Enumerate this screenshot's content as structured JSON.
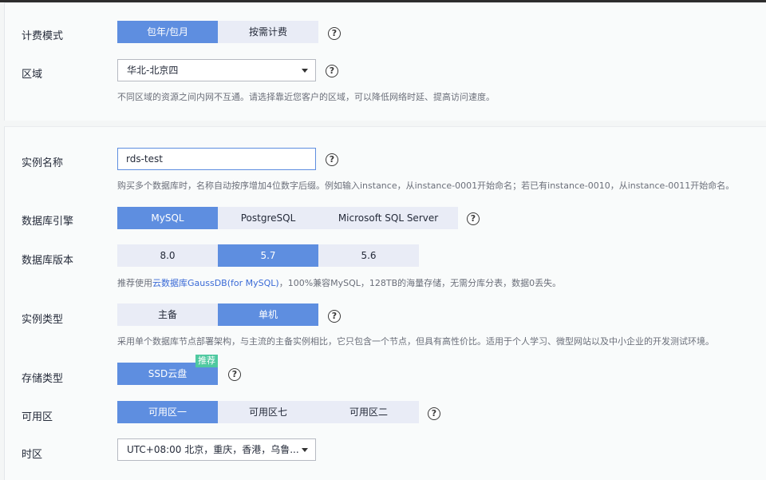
{
  "billing": {
    "label": "计费模式",
    "options": [
      "包年/包月",
      "按需计费"
    ],
    "selected": "包年/包月"
  },
  "region": {
    "label": "区域",
    "value": "华北-北京四",
    "hint": "不同区域的资源之间内网不互通。请选择靠近您客户的区域，可以降低网络时延、提高访问速度。"
  },
  "instance_name": {
    "label": "实例名称",
    "value": "rds-test",
    "hint": "购买多个数据库时，名称自动按序增加4位数字后缀。例如输入instance，从instance-0001开始命名；若已有instance-0010，从instance-0011开始命名。"
  },
  "engine": {
    "label": "数据库引擎",
    "options": [
      "MySQL",
      "PostgreSQL",
      "Microsoft SQL Server"
    ],
    "selected": "MySQL"
  },
  "version": {
    "label": "数据库版本",
    "options": [
      "8.0",
      "5.7",
      "5.6"
    ],
    "selected": "5.7",
    "hint_prefix": "推荐使用",
    "hint_link": "云数据库GaussDB(for MySQL)",
    "hint_suffix": "，100%兼容MySQL，128TB的海量存储，无需分库分表，数据0丢失。"
  },
  "instance_type": {
    "label": "实例类型",
    "options": [
      "主备",
      "单机"
    ],
    "selected": "单机",
    "hint": "采用单个数据库节点部署架构，与主流的主备实例相比，它只包含一个节点，但具有高性价比。适用于个人学习、微型网站以及中小企业的开发测试环境。"
  },
  "storage": {
    "label": "存储类型",
    "option": "SSD云盘",
    "badge": "推荐"
  },
  "az": {
    "label": "可用区",
    "options": [
      "可用区一",
      "可用区七",
      "可用区二"
    ],
    "selected": "可用区一"
  },
  "timezone": {
    "label": "时区",
    "value": "UTC+08:00 北京，重庆，香港，乌鲁..."
  },
  "help_glyph": "?",
  "colors": {
    "accent": "#5e8ee0",
    "segment_bg": "#e9ecf6",
    "badge": "#4fc9a0",
    "link": "#3a6ad6"
  }
}
